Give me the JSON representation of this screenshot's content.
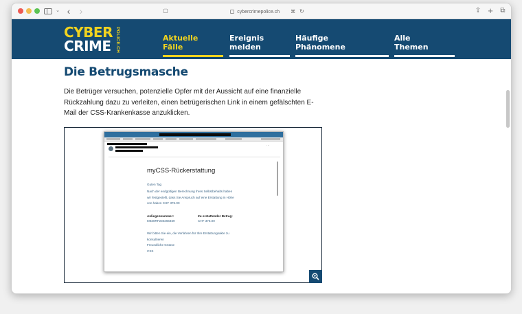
{
  "browser": {
    "url": "cybercrimepolice.ch"
  },
  "site": {
    "logo_top": "CYBER",
    "logo_bottom": "CRIME",
    "logo_side": "POLICE.CH",
    "nav": [
      {
        "line1": "Aktuelle",
        "line2": "Fälle",
        "active": true
      },
      {
        "line1": "Ereignis",
        "line2": "melden",
        "active": false
      },
      {
        "line1": "Häufige",
        "line2": "Phänomene",
        "active": false
      },
      {
        "line1": "Alle",
        "line2": "Themen",
        "active": false
      }
    ]
  },
  "article": {
    "heading": "Die Betrugsmasche",
    "paragraph": "Die Betrüger versuchen, potenzielle Opfer mit der Aussicht auf eine finanzielle Rückzahlung dazu zu verleiten, einen betrügerischen Link in einem gefälschten E-Mail der CSS-Krankenkasse anzuklicken."
  },
  "email_mock": {
    "title": "myCSS-Rückerstattung",
    "greeting": "Guten Tag",
    "body_lines": [
      "Nach der endgültigen Berechnung Ihres Selbstbehalts haben",
      "wir festgestellt, dass Sie Anspruch auf eine Erstattung in Höhe",
      "von haben CHF 376.00"
    ],
    "ref_label": "Anliegennummer:",
    "ref_value": "I0830RF230266469",
    "amount_label": "Zu erstattender Betrag:",
    "amount_value": "CHF 376.00",
    "closing_lines": [
      "Wir bitten Sie ein, die Verfahren für Ihre Erstattungsakte zu",
      "konsultieren"
    ],
    "signoff": "Freundliche Grüsse",
    "sender": "CSS"
  },
  "colors": {
    "brand_navy": "#154a72",
    "brand_yellow": "#f1d31f"
  },
  "icons": {
    "zoom": "magnifier-plus-icon"
  }
}
